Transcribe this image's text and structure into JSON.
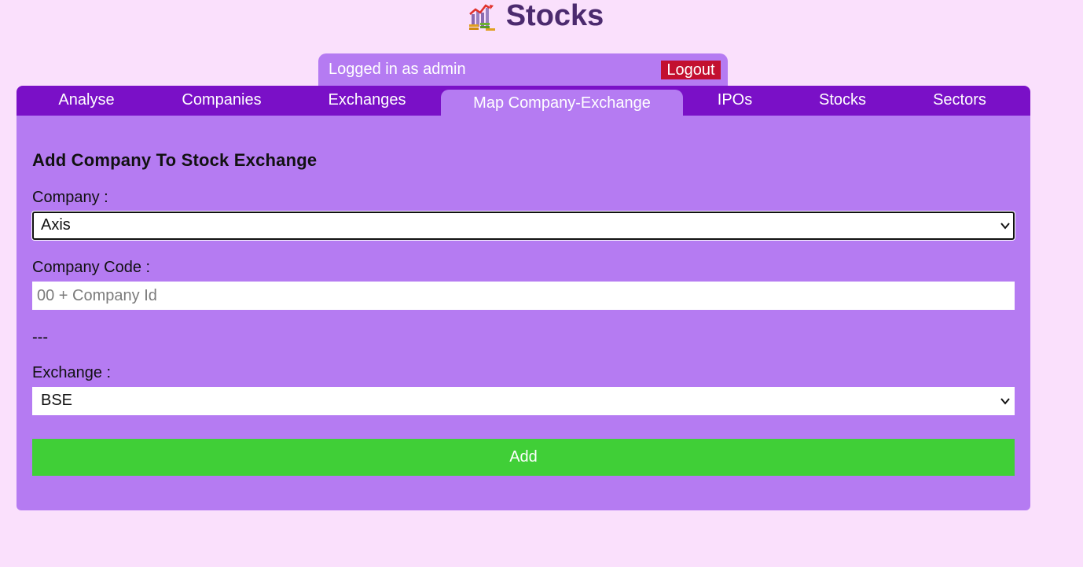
{
  "app": {
    "title": "Stocks",
    "logo_icon": "stock-chart-coins-icon"
  },
  "user_bar": {
    "status_text": "Logged in as admin",
    "logout_label": "Logout"
  },
  "tabs": [
    {
      "label": "Analyse",
      "active": false
    },
    {
      "label": "Companies",
      "active": false
    },
    {
      "label": "Exchanges",
      "active": false
    },
    {
      "label": "Map Company-Exchange",
      "active": true
    },
    {
      "label": "IPOs",
      "active": false
    },
    {
      "label": "Stocks",
      "active": false
    },
    {
      "label": "Sectors",
      "active": false
    }
  ],
  "form": {
    "title": "Add Company To Stock Exchange",
    "company_label": "Company :",
    "company_value": "Axis",
    "company_code_label": "Company Code :",
    "company_code_placeholder": "00 + Company Id",
    "company_code_value": "",
    "separator": "---",
    "exchange_label": "Exchange :",
    "exchange_value": "BSE",
    "submit_label": "Add"
  },
  "colors": {
    "page_background": "#fae0fc",
    "title": "#4b2a6e",
    "tab_bar": "#7a10c7",
    "panel": "#b57bf2",
    "logout": "#c3102f",
    "add_button": "#40cf37"
  }
}
